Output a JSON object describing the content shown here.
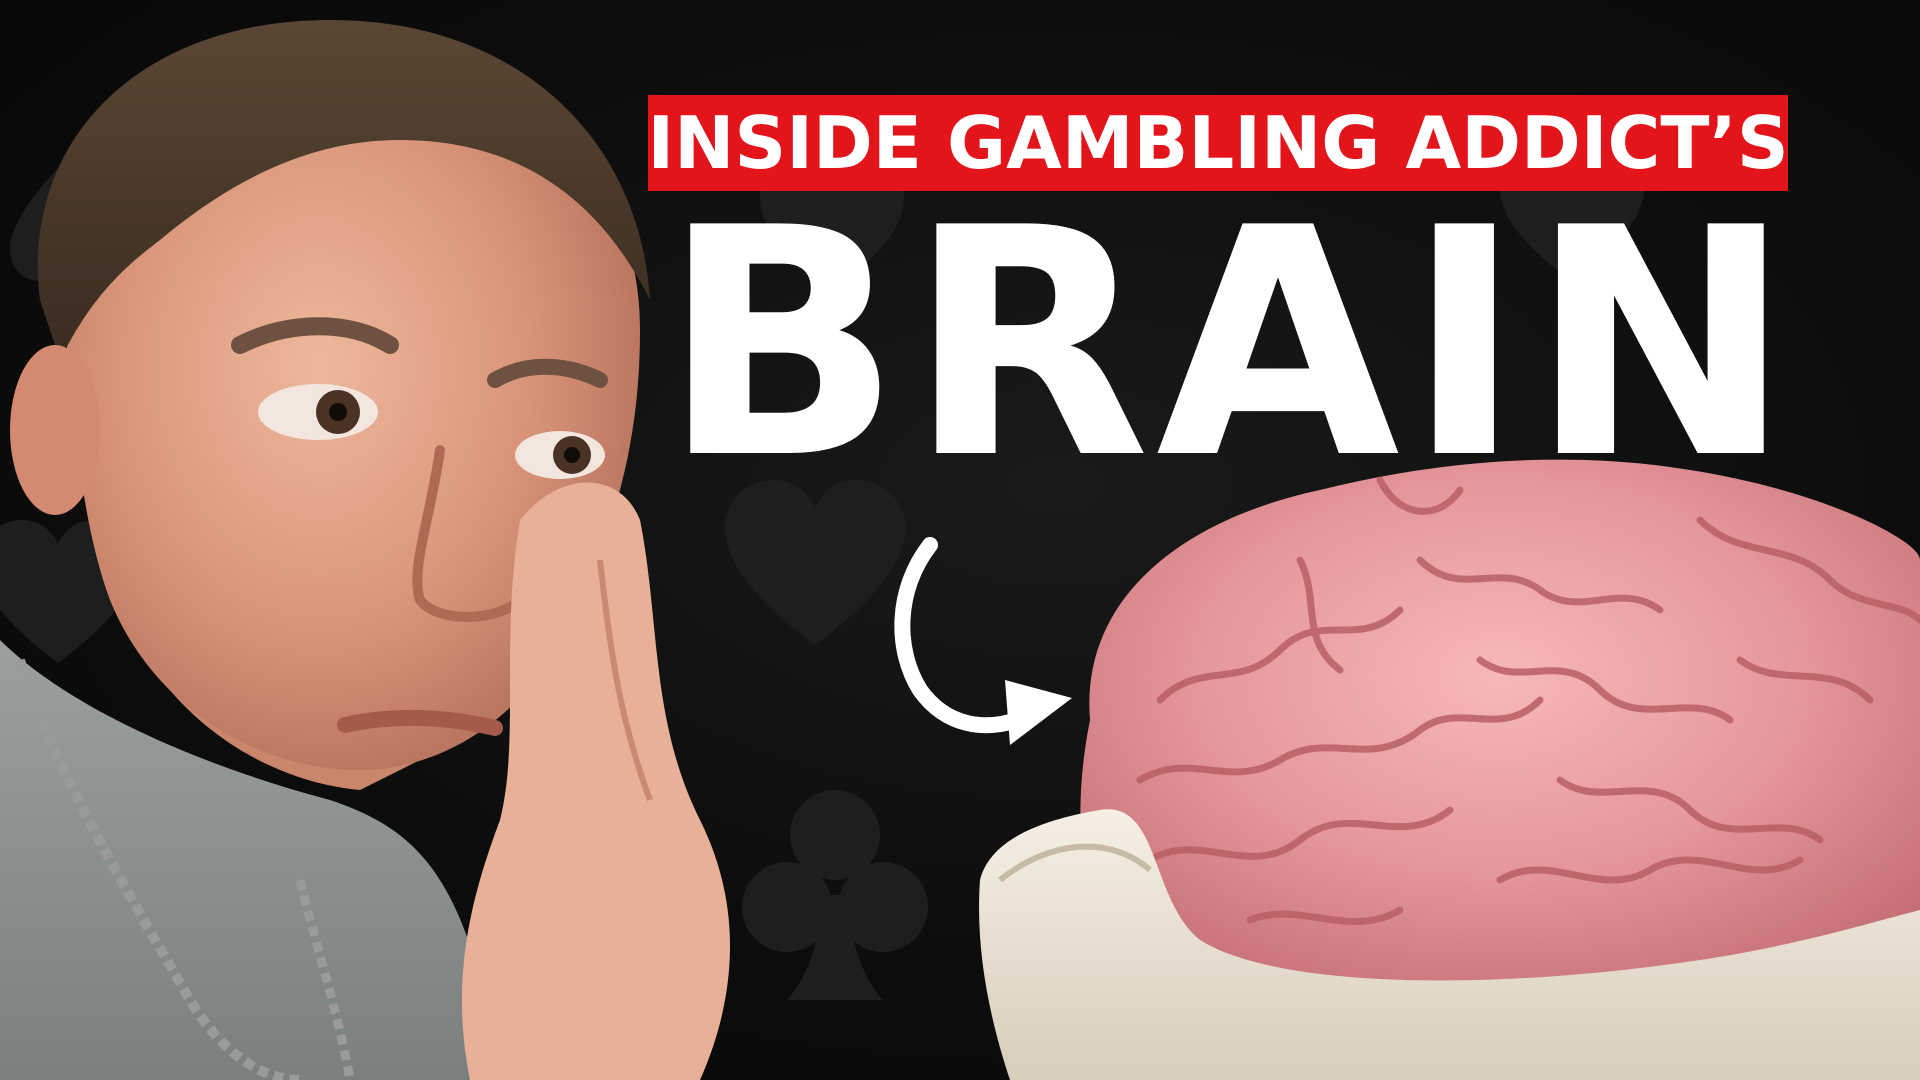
{
  "thumbnail": {
    "tagline": "INSIDE GAMBLING ADDICT’S",
    "headline": "BRAIN"
  },
  "colors": {
    "background": "#0d0d0d",
    "suit_watermark": "#1e1e1e",
    "tagline_box": "#e3141a",
    "text": "#ffffff",
    "brain": "#e89a9e",
    "skull_bowl": "#efe6d8",
    "shirt": "#8c9190",
    "skin": "#e0a184",
    "hair": "#4a3a2c"
  },
  "icons": [
    "spade-watermark-icon",
    "heart-watermark-icon",
    "club-watermark-icon",
    "curved-arrow-icon"
  ]
}
